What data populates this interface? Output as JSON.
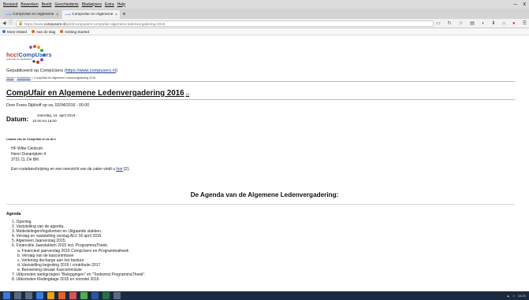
{
  "menubar": {
    "items": [
      "Bestand",
      "Bewerken",
      "Beeld",
      "Geschiedenis",
      "Bladwijzers",
      "Extra",
      "Help"
    ],
    "minimize": "–",
    "close": "x"
  },
  "tabs": [
    {
      "title": "CompUfair en Algemene ...",
      "close": "×"
    },
    {
      "title": "CompUfair en Algemene ...",
      "close": "×"
    }
  ],
  "new_tab": "+",
  "urlbar": {
    "prefix": "https://www.",
    "domain": "compusers.nl",
    "path": "/print/compusers-compufair-algemene-ledenvergadering-2016"
  },
  "bookmarks": [
    {
      "label": "Most Visited",
      "color": "#3a7bd5"
    },
    {
      "label": "Aan de slag",
      "color": "#e0632b"
    },
    {
      "label": "Getting Started",
      "color": "#e0632b"
    }
  ],
  "logo": {
    "prefix": "hcc!",
    "brand": "CompUsers",
    "tagline": "systemen en applicaties"
  },
  "page": {
    "published_prefix": "Gepubliceerd op CompUsers (",
    "published_link": "https://www.compusers.nl",
    "published_suffix": ")",
    "breadcrumb": {
      "home": "Home",
      "sep": " > ",
      "agenda": "Activiteiten",
      "current": " > CompUfair en Algemene Ledenvergadering 2016"
    },
    "title": "CompUfair en Algemene Ledenvergadering 2016",
    "title_ext": "[1]",
    "byline": "Door Frans Dijkhoff op za, 02/04/2016 - 00:00",
    "datum_label": "Datum:",
    "datum_line1": "zaterdag, 16. april 2016 -",
    "datum_line2": "10:00 tot 16:00",
    "lokatie_heading": "Lokatie van de CompUfair en de ALV:",
    "address": [
      "HF Witte Centrum",
      "Henri Dunantplein 4",
      "3731 CL  De Bilt"
    ],
    "route_text": "Een routebeschrijving en een overzicht van de zalen vindt u ",
    "route_link": "hier",
    "route_ref": " [2].",
    "agenda_title": "De Agenda van de Algemene Ledenvergadering:",
    "agenda_label": "Agenda",
    "agenda_items": [
      {
        "text": "1. Opening.",
        "sub": false
      },
      {
        "text": "2. Vaststelling van de agenda.",
        "sub": false
      },
      {
        "text": "3. Mededelingen/Ingekomen en Uitgaande stukken.",
        "sub": false
      },
      {
        "text": "4. Verslag en vaststelling verslag ALV 18 april 2015.",
        "sub": false
      },
      {
        "text": "5. Algemeen Jaarverslag 2015.",
        "sub": false
      },
      {
        "text": "6. Financiële Jaarstukken 2015 incl. ProgrammaTheek.",
        "sub": false
      },
      {
        "text": "a. Financieel jaarverslag 2015 CompUsers en Programmatheek",
        "sub": true
      },
      {
        "text": "b. Verslag van de kascommissie",
        "sub": true
      },
      {
        "text": "c. Verlening decharge aan het bestuur",
        "sub": true
      },
      {
        "text": "d. Vaststelling begroting 2016 / contributie 2017",
        "sub": true
      },
      {
        "text": "e. Benoeming nieuwe Kascommissie",
        "sub": true
      },
      {
        "text": "7. Uitkomsten werkgroepen \"Beleggingen\" en \"Toekomst ProgrammaTheek\".",
        "sub": false
      },
      {
        "text": "8. Uitkomsten Kledingdage 2015 en voorstel 2016",
        "sub": false
      }
    ]
  },
  "taskbar": {
    "clock": "14:21"
  }
}
